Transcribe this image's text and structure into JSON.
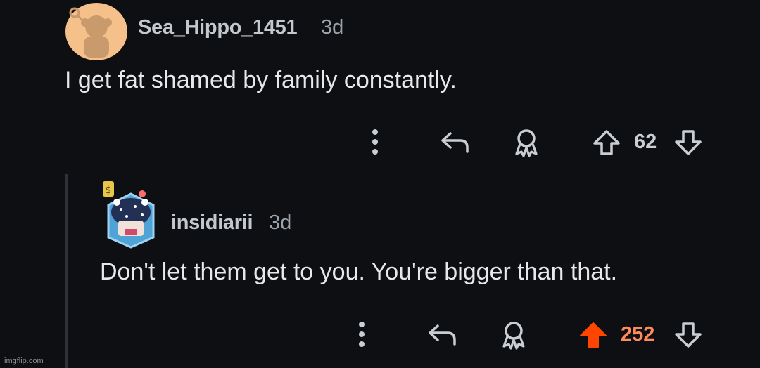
{
  "comments": [
    {
      "username": "Sea_Hippo_1451",
      "age": "3d",
      "body": "I get fat shamed by family constantly.",
      "score": "62",
      "voted": false
    },
    {
      "username": "insidiarii",
      "age": "3d",
      "body": "Don't let them get to you. You're bigger than that.",
      "score": "252",
      "voted": true
    }
  ],
  "colors": {
    "background": "#0e0f12",
    "upvote_active": "#ff4500",
    "score_active": "#ff8a5b",
    "avatar_peach": "#f5c08a"
  },
  "icons": [
    "more-options-icon",
    "reply-icon",
    "award-icon",
    "upvote-icon",
    "downvote-icon"
  ],
  "watermark": "imgflip.com"
}
